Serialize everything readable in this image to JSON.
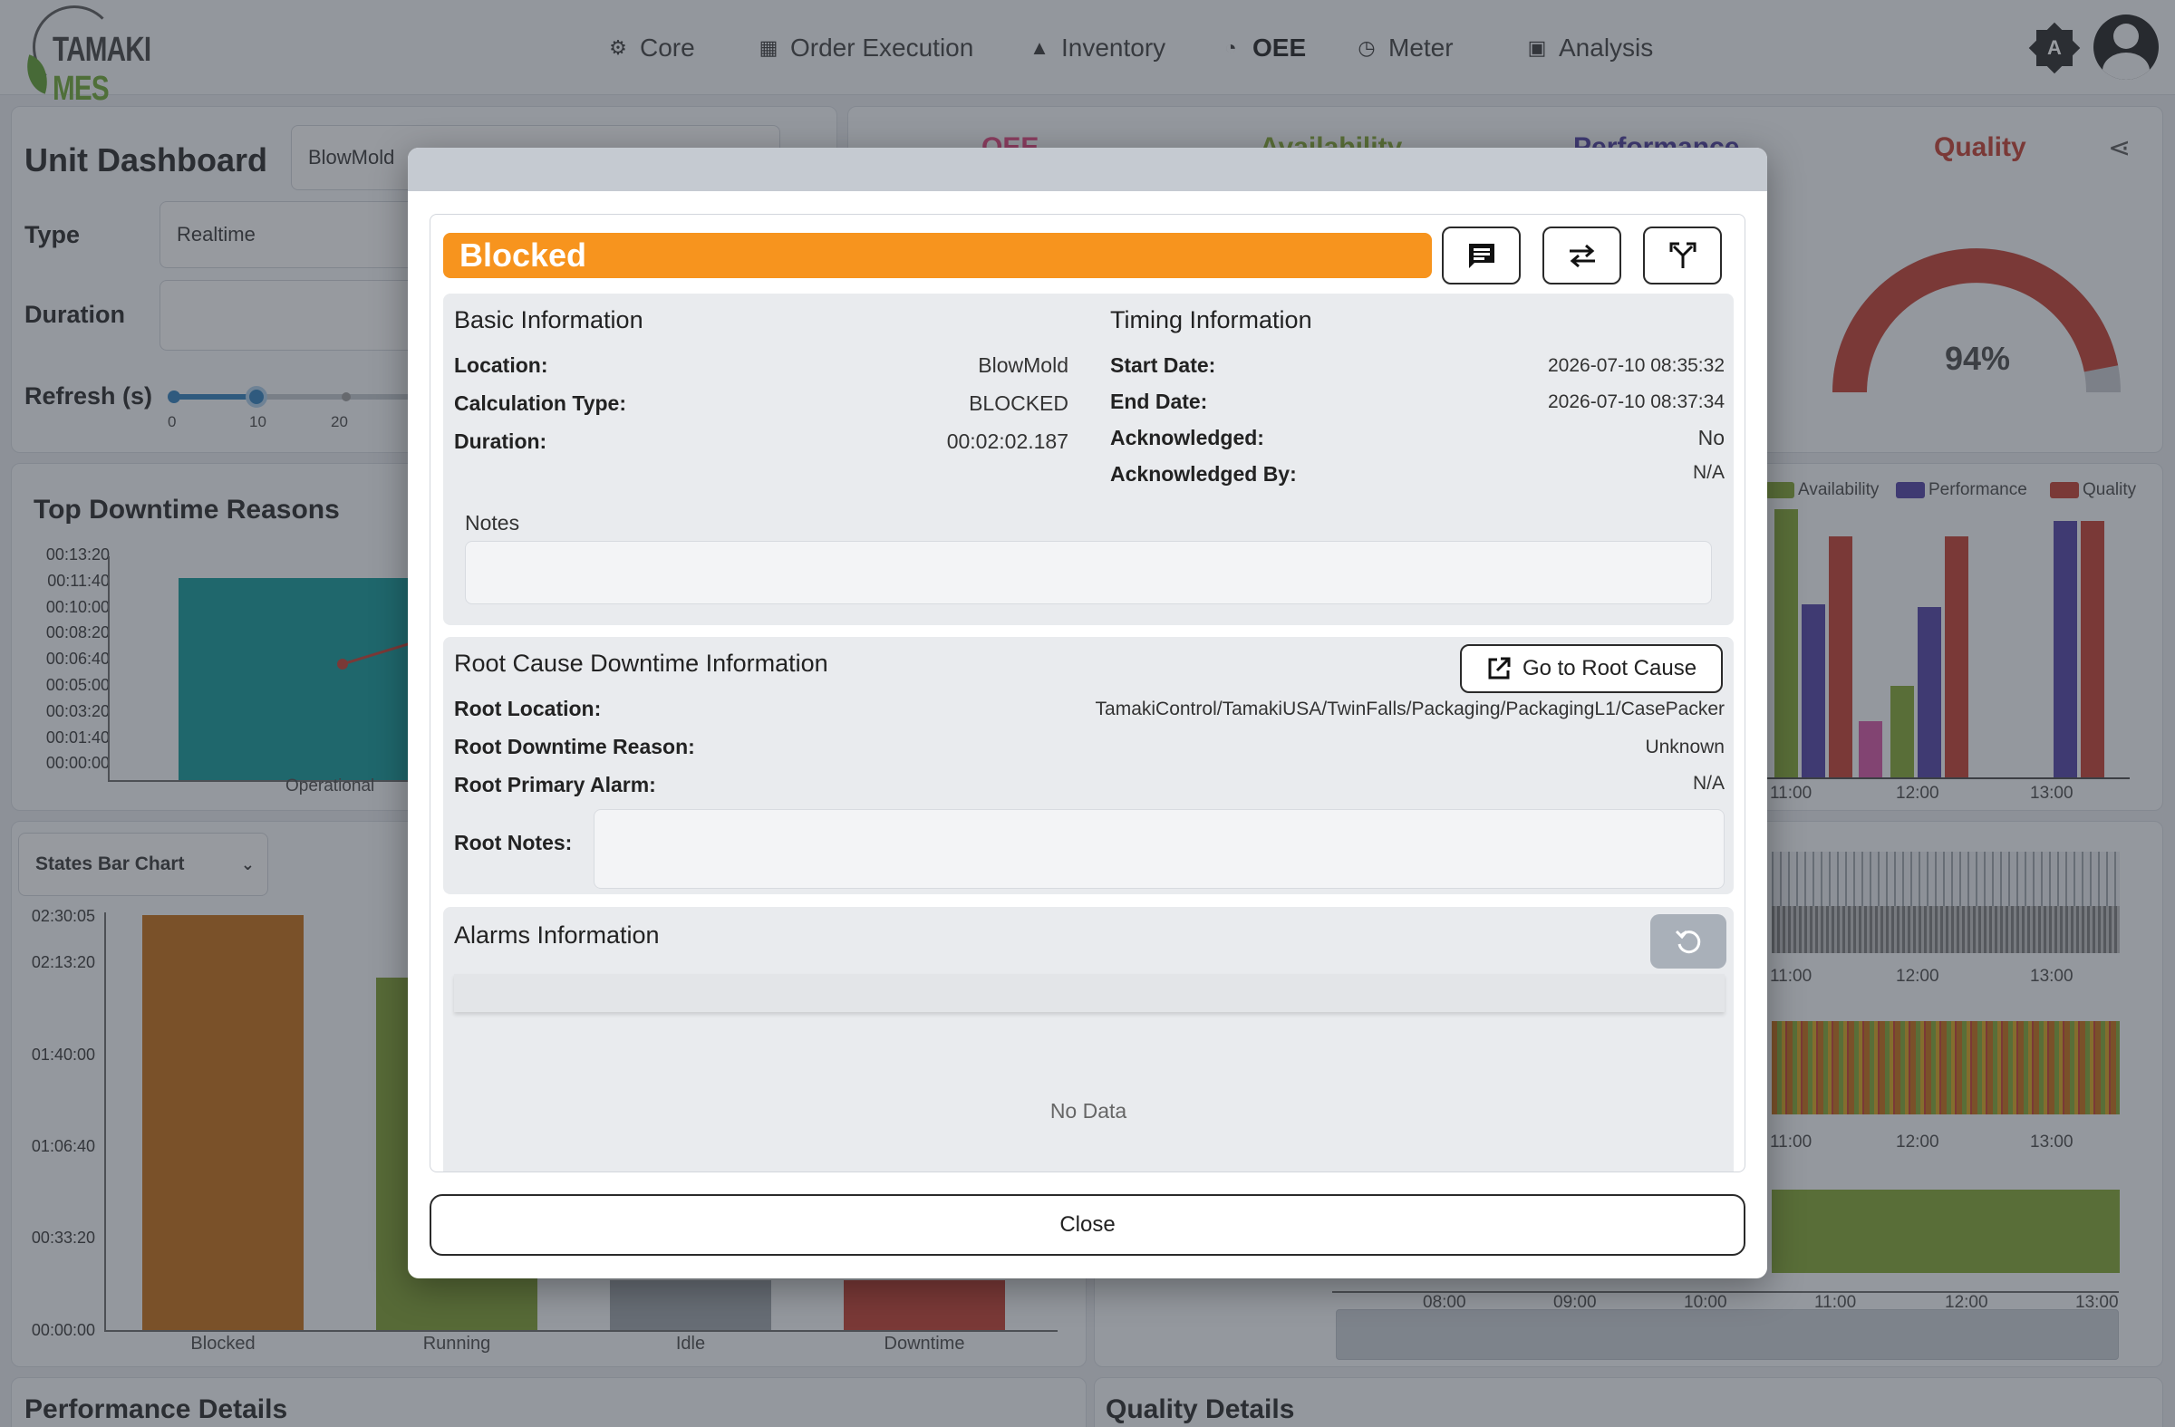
{
  "app": {
    "logo_part1": "TAMAKI ",
    "logo_part2": "MES",
    "theme_letter": "A"
  },
  "nav": [
    {
      "label": "Core",
      "icon": "gear-icon"
    },
    {
      "label": "Order Execution",
      "icon": "calendar-icon"
    },
    {
      "label": "Inventory",
      "icon": "boxes-icon"
    },
    {
      "label": "OEE",
      "icon": "gauge-icon"
    },
    {
      "label": "Meter",
      "icon": "meter-icon"
    },
    {
      "label": "Analysis",
      "icon": "chart-icon"
    }
  ],
  "dashboard": {
    "title": "Unit Dashboard",
    "unit_value": "BlowMold",
    "type_label": "Type",
    "type_value": "Realtime",
    "duration_label": "Duration",
    "refresh_label": "Refresh (s)",
    "refresh_value": 10,
    "refresh_ticks": [
      "0",
      "10",
      "20"
    ]
  },
  "oee_tabs": [
    "OEE",
    "Availability",
    "Performance",
    "Quality"
  ],
  "quality_gauge": {
    "value_text": "94%",
    "value": 0.94,
    "color": "#c0392b"
  },
  "legend": [
    "Availability",
    "Performance",
    "Quality"
  ],
  "right_time_ticks": [
    "11:00",
    "12:00",
    "13:00"
  ],
  "bottom_time_ticks": [
    "08:00",
    "09:00",
    "10:00",
    "11:00",
    "12:00",
    "13:00"
  ],
  "top_downtime": {
    "title": "Top Downtime Reasons",
    "yticks": [
      "00:13:20",
      "00:11:40",
      "00:10:00",
      "00:08:20",
      "00:06:40",
      "00:05:00",
      "00:03:20",
      "00:01:40",
      "00:00:00"
    ],
    "category": "Operational"
  },
  "states_chart": {
    "select_label": "States Bar Chart",
    "yticks": [
      "02:30:05",
      "02:13:20",
      "01:40:00",
      "01:06:40",
      "00:33:20",
      "00:00:00"
    ],
    "categories": [
      "Blocked",
      "Running",
      "Idle",
      "Downtime"
    ],
    "colors": [
      "#c1680f",
      "#7a9b2a",
      "#9aa0a6",
      "#c0392b"
    ]
  },
  "section_titles": {
    "performance": "Performance Details",
    "quality": "Quality Details"
  },
  "modal": {
    "state": "Blocked",
    "state_color": "#f7941e",
    "basic": {
      "title": "Basic Information",
      "rows": [
        {
          "k": "Location:",
          "v": "BlowMold"
        },
        {
          "k": "Calculation Type:",
          "v": "BLOCKED"
        },
        {
          "k": "Duration:",
          "v": "00:02:02.187"
        }
      ]
    },
    "timing": {
      "title": "Timing Information",
      "rows": [
        {
          "k": "Start Date:",
          "v": "2026-07-10 08:35:32"
        },
        {
          "k": "End Date:",
          "v": "2026-07-10 08:37:34"
        },
        {
          "k": "Acknowledged:",
          "v": "No"
        },
        {
          "k": "Acknowledged By:",
          "v": "N/A"
        }
      ]
    },
    "notes_label": "Notes",
    "root": {
      "title": "Root Cause Downtime Information",
      "button": "Go to Root Cause",
      "rows": [
        {
          "k": "Root Location:",
          "v": "TamakiControl/TamakiUSA/TwinFalls/Packaging/PackagingL1/CasePacker"
        },
        {
          "k": "Root Downtime Reason:",
          "v": "Unknown"
        },
        {
          "k": "Root Primary Alarm:",
          "v": "N/A"
        }
      ],
      "notes_label": "Root Notes:"
    },
    "alarms": {
      "title": "Alarms Information",
      "empty": "No Data"
    },
    "close": "Close"
  }
}
